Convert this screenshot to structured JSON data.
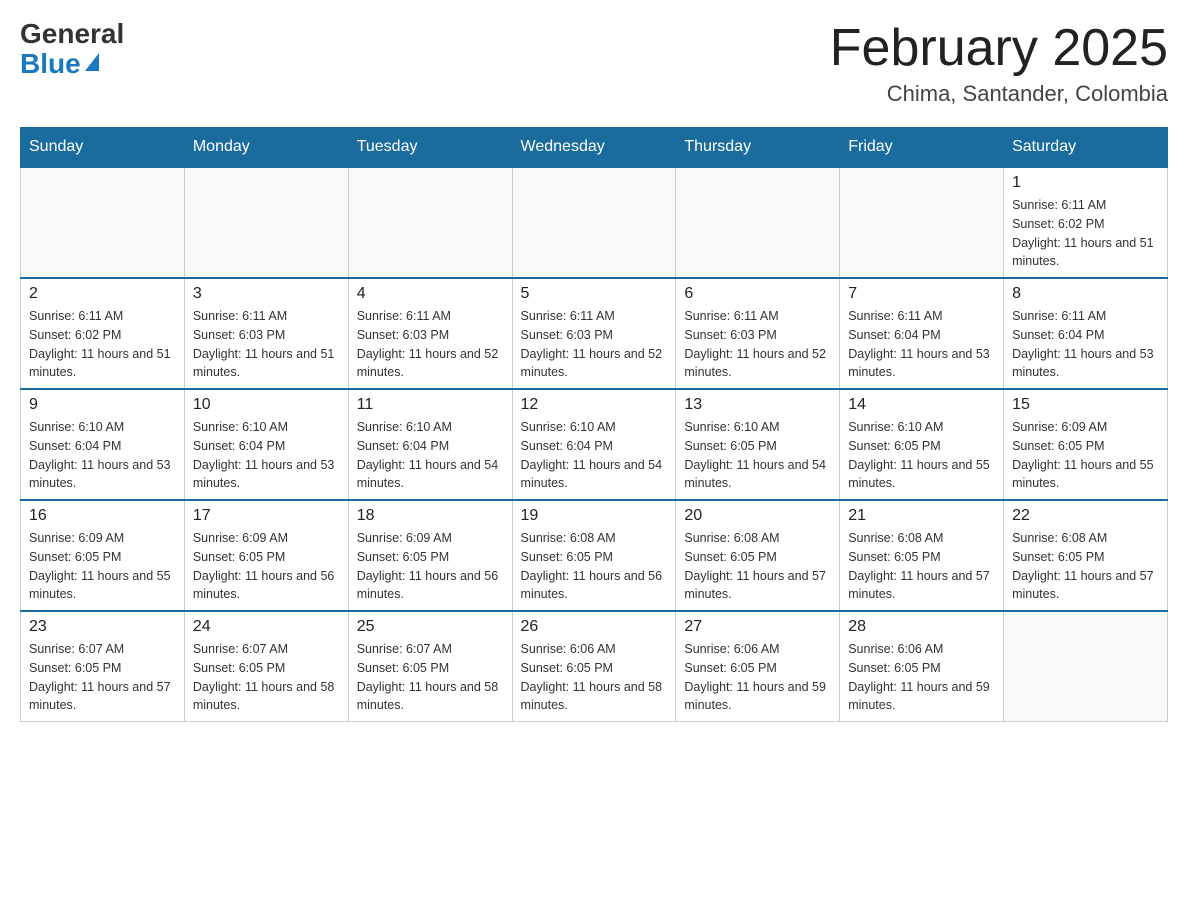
{
  "logo": {
    "general": "General",
    "blue": "Blue"
  },
  "title": {
    "month": "February 2025",
    "location": "Chima, Santander, Colombia"
  },
  "days_of_week": [
    "Sunday",
    "Monday",
    "Tuesday",
    "Wednesday",
    "Thursday",
    "Friday",
    "Saturday"
  ],
  "weeks": [
    [
      {
        "day": "",
        "info": ""
      },
      {
        "day": "",
        "info": ""
      },
      {
        "day": "",
        "info": ""
      },
      {
        "day": "",
        "info": ""
      },
      {
        "day": "",
        "info": ""
      },
      {
        "day": "",
        "info": ""
      },
      {
        "day": "1",
        "info": "Sunrise: 6:11 AM\nSunset: 6:02 PM\nDaylight: 11 hours and 51 minutes."
      }
    ],
    [
      {
        "day": "2",
        "info": "Sunrise: 6:11 AM\nSunset: 6:02 PM\nDaylight: 11 hours and 51 minutes."
      },
      {
        "day": "3",
        "info": "Sunrise: 6:11 AM\nSunset: 6:03 PM\nDaylight: 11 hours and 51 minutes."
      },
      {
        "day": "4",
        "info": "Sunrise: 6:11 AM\nSunset: 6:03 PM\nDaylight: 11 hours and 52 minutes."
      },
      {
        "day": "5",
        "info": "Sunrise: 6:11 AM\nSunset: 6:03 PM\nDaylight: 11 hours and 52 minutes."
      },
      {
        "day": "6",
        "info": "Sunrise: 6:11 AM\nSunset: 6:03 PM\nDaylight: 11 hours and 52 minutes."
      },
      {
        "day": "7",
        "info": "Sunrise: 6:11 AM\nSunset: 6:04 PM\nDaylight: 11 hours and 53 minutes."
      },
      {
        "day": "8",
        "info": "Sunrise: 6:11 AM\nSunset: 6:04 PM\nDaylight: 11 hours and 53 minutes."
      }
    ],
    [
      {
        "day": "9",
        "info": "Sunrise: 6:10 AM\nSunset: 6:04 PM\nDaylight: 11 hours and 53 minutes."
      },
      {
        "day": "10",
        "info": "Sunrise: 6:10 AM\nSunset: 6:04 PM\nDaylight: 11 hours and 53 minutes."
      },
      {
        "day": "11",
        "info": "Sunrise: 6:10 AM\nSunset: 6:04 PM\nDaylight: 11 hours and 54 minutes."
      },
      {
        "day": "12",
        "info": "Sunrise: 6:10 AM\nSunset: 6:04 PM\nDaylight: 11 hours and 54 minutes."
      },
      {
        "day": "13",
        "info": "Sunrise: 6:10 AM\nSunset: 6:05 PM\nDaylight: 11 hours and 54 minutes."
      },
      {
        "day": "14",
        "info": "Sunrise: 6:10 AM\nSunset: 6:05 PM\nDaylight: 11 hours and 55 minutes."
      },
      {
        "day": "15",
        "info": "Sunrise: 6:09 AM\nSunset: 6:05 PM\nDaylight: 11 hours and 55 minutes."
      }
    ],
    [
      {
        "day": "16",
        "info": "Sunrise: 6:09 AM\nSunset: 6:05 PM\nDaylight: 11 hours and 55 minutes."
      },
      {
        "day": "17",
        "info": "Sunrise: 6:09 AM\nSunset: 6:05 PM\nDaylight: 11 hours and 56 minutes."
      },
      {
        "day": "18",
        "info": "Sunrise: 6:09 AM\nSunset: 6:05 PM\nDaylight: 11 hours and 56 minutes."
      },
      {
        "day": "19",
        "info": "Sunrise: 6:08 AM\nSunset: 6:05 PM\nDaylight: 11 hours and 56 minutes."
      },
      {
        "day": "20",
        "info": "Sunrise: 6:08 AM\nSunset: 6:05 PM\nDaylight: 11 hours and 57 minutes."
      },
      {
        "day": "21",
        "info": "Sunrise: 6:08 AM\nSunset: 6:05 PM\nDaylight: 11 hours and 57 minutes."
      },
      {
        "day": "22",
        "info": "Sunrise: 6:08 AM\nSunset: 6:05 PM\nDaylight: 11 hours and 57 minutes."
      }
    ],
    [
      {
        "day": "23",
        "info": "Sunrise: 6:07 AM\nSunset: 6:05 PM\nDaylight: 11 hours and 57 minutes."
      },
      {
        "day": "24",
        "info": "Sunrise: 6:07 AM\nSunset: 6:05 PM\nDaylight: 11 hours and 58 minutes."
      },
      {
        "day": "25",
        "info": "Sunrise: 6:07 AM\nSunset: 6:05 PM\nDaylight: 11 hours and 58 minutes."
      },
      {
        "day": "26",
        "info": "Sunrise: 6:06 AM\nSunset: 6:05 PM\nDaylight: 11 hours and 58 minutes."
      },
      {
        "day": "27",
        "info": "Sunrise: 6:06 AM\nSunset: 6:05 PM\nDaylight: 11 hours and 59 minutes."
      },
      {
        "day": "28",
        "info": "Sunrise: 6:06 AM\nSunset: 6:05 PM\nDaylight: 11 hours and 59 minutes."
      },
      {
        "day": "",
        "info": ""
      }
    ]
  ]
}
